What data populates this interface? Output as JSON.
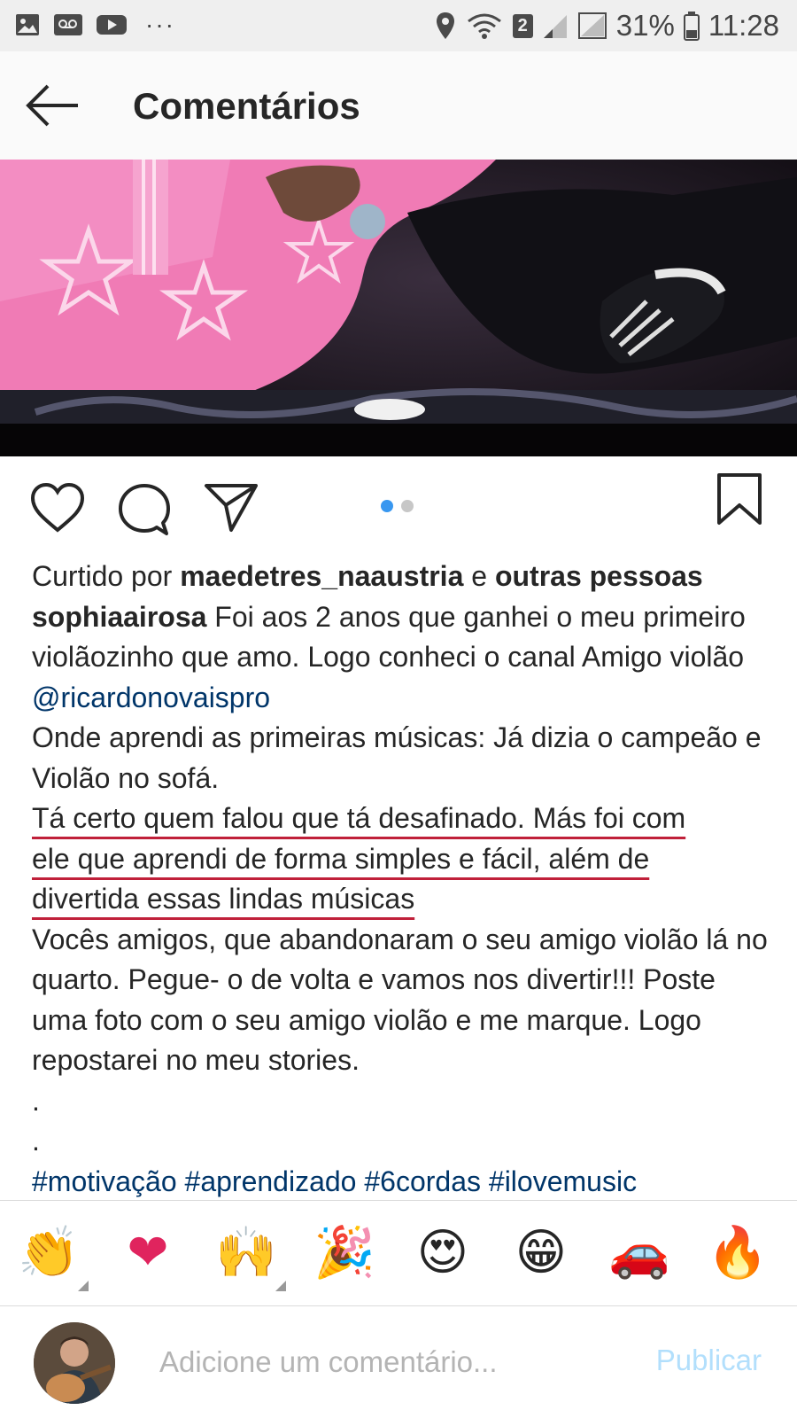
{
  "status_bar": {
    "notification_icons": [
      "image-icon",
      "voicemail-icon",
      "youtube-icon"
    ],
    "more": "···",
    "sim_badge": "2",
    "battery_percent": "31%",
    "time": "11:28"
  },
  "header": {
    "back_icon": "arrow-left-icon",
    "title": "Comentários"
  },
  "post": {
    "photo_description": "pink-guitar-photo",
    "carousel": {
      "count": 2,
      "active_index": 0
    },
    "actions": [
      "heart-icon",
      "comment-icon",
      "share-icon",
      "bookmark-icon"
    ]
  },
  "caption": {
    "liked_prefix": "Curtido por",
    "liked_user": "maedetres_naaustria",
    "liked_conj": "e",
    "liked_others": "outras pessoas",
    "author": "sophiaairosa",
    "line1_text": "Foi aos 2 anos que ganhei o meu primeiro violãozinho que amo. Logo conheci o canal Amigo violão",
    "mention": "@ricardonovaispro",
    "para2": "Onde aprendi as primeiras músicas: Já dizia o campeão e Violão no sofá.",
    "underlined_1": "Tá certo quem falou que tá desafinado. Más foi com",
    "underlined_2": "ele que aprendi de forma simples e fácil, além de",
    "underlined_3": "divertida essas lindas músicas",
    "para4": "Vocês amigos, que abandonaram o seu amigo violão lá no quarto. Pegue- o de volta e vamos nos divertir!!! Poste uma foto com o seu amigo violão e me marque. Logo repostarei no meu stories.",
    "dot1": ".",
    "dot2": ".",
    "hashtags": "#motivação #aprendizado #6cordas #ilovemusic"
  },
  "emoji_bar": [
    {
      "name": "clapping-hands-emoji",
      "glyph": "👏"
    },
    {
      "name": "red-heart-emoji",
      "glyph": "❤"
    },
    {
      "name": "raising-hands-emoji",
      "glyph": "🙌"
    },
    {
      "name": "party-popper-emoji",
      "glyph": "🎉"
    },
    {
      "name": "heart-eyes-emoji",
      "glyph": "😍"
    },
    {
      "name": "grinning-emoji",
      "glyph": "😁"
    },
    {
      "name": "red-car-emoji",
      "glyph": "🚗"
    },
    {
      "name": "fire-emoji",
      "glyph": "🔥"
    }
  ],
  "comment_bar": {
    "placeholder": "Adicione um comentário...",
    "publish_label": "Publicar"
  }
}
